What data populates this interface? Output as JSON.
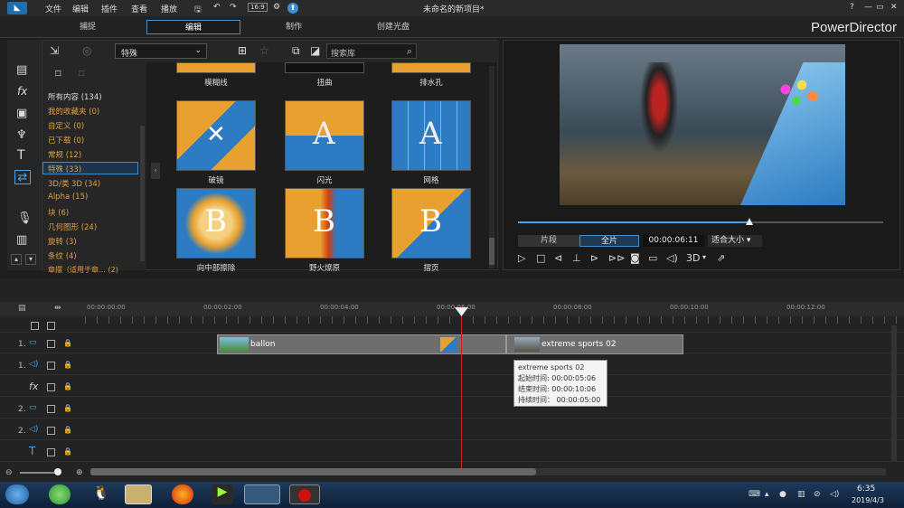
{
  "titlebar": {
    "menus": [
      "文件",
      "编辑",
      "插件",
      "查看",
      "播放"
    ],
    "project_title": "未命名的新项目*",
    "help": "?",
    "minimize": "—",
    "restore": "▭",
    "close": "✕"
  },
  "modes": {
    "capture": "捕捉",
    "edit": "编辑",
    "produce": "制作",
    "create_disc": "创建光盘"
  },
  "brand": "PowerDirector",
  "library": {
    "filter_selected": "特殊",
    "search_placeholder": "搜索库",
    "categories": [
      "所有内容 (134)",
      "我的收藏夹 (0)",
      "自定义 (0)",
      "已下载 (0)",
      "常规 (12)",
      "特殊 (33)",
      "3D/类 3D (34)",
      "Alpha (15)",
      "块 (6)",
      "几何图形 (24)",
      "旋转 (3)",
      "条纹 (4)",
      "章摆（适用于章… (2)"
    ],
    "thumbnails": [
      "模糊线",
      "扭曲",
      "排水孔",
      "破镜",
      "闪光",
      "网格",
      "向中部擦除",
      "野火燎原",
      "摺页"
    ]
  },
  "preview": {
    "clip_label": "片段",
    "full_label": "全片",
    "timecode": "00:00:06:11",
    "fit_label": "适合大小",
    "mode_3d": "3D"
  },
  "timeline": {
    "ruler": [
      "00:00:00:00",
      "00:00:02:00",
      "00:00:04:00",
      "00:00:06:00",
      "00:00:08:00",
      "00:00:10:00",
      "00:00:12:00"
    ],
    "tracks": [
      {
        "num": "1."
      },
      {
        "num": "1."
      },
      {
        "num": ""
      },
      {
        "num": "2."
      },
      {
        "num": "2."
      },
      {
        "num": ""
      }
    ],
    "clips": {
      "clip1": "ballon",
      "clip2": "extreme sports 02"
    },
    "tooltip": {
      "name": "extreme sports 02",
      "start": "起始时间: 00:00:05:06",
      "end": "结束时间: 00:00:10:06",
      "duration": "持续时间： 00:00:05:00"
    },
    "playhead_value": "00:00:06:11"
  },
  "taskbar": {
    "time": "6:35",
    "date": "2019/4/3"
  },
  "colors": {
    "accent": "#3e8ed0",
    "category_text": "#e0a040",
    "clip_bg": "#6e6e6e"
  }
}
